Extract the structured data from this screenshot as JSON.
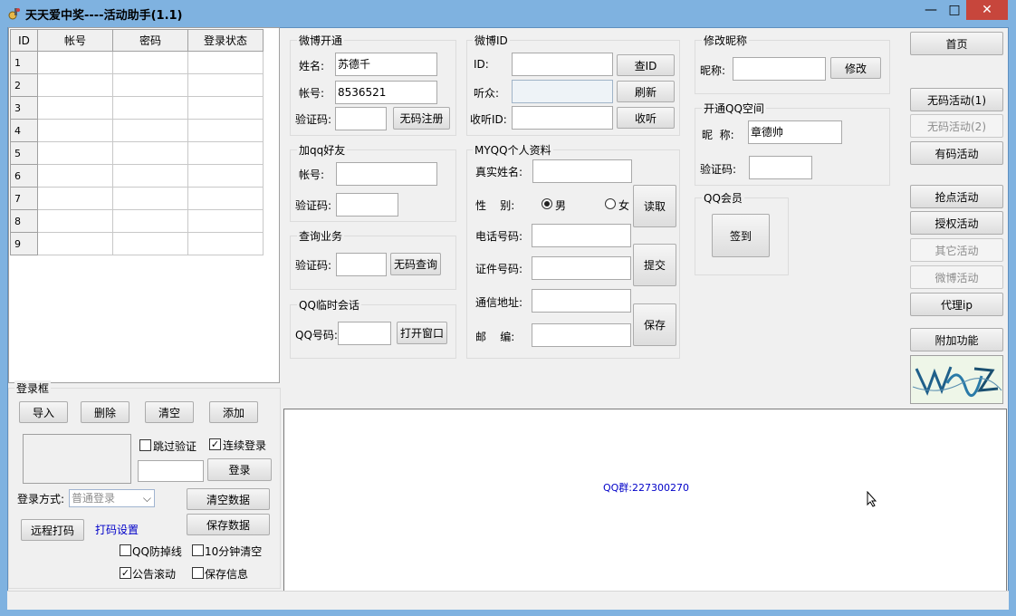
{
  "window": {
    "title": "天天爱中奖----活动助手(1.1)",
    "min_label": "—",
    "max_label": "□",
    "close_label": "✕"
  },
  "accounts": {
    "headers": [
      "ID",
      "帐号",
      "密码",
      "登录状态"
    ],
    "rows": [
      "1",
      "2",
      "3",
      "4",
      "5",
      "6",
      "7",
      "8",
      "9"
    ]
  },
  "login_box": {
    "group_label": "登录框",
    "import": "导入",
    "delete": "删除",
    "clear": "清空",
    "add": "添加",
    "skip_verify": "跳过验证",
    "continuous_login": "连续登录",
    "login": "登录",
    "login_mode_label": "登录方式:",
    "login_mode_value": "普通登录",
    "clear_data": "清空数据",
    "save_data": "保存数据",
    "remote_captcha": "远程打码",
    "captcha_settings": "打码设置",
    "qq_anti_drop": "QQ防掉线",
    "clear_10min": "10分钟清空",
    "notice_scroll": "公告滚动",
    "save_info": "保存信息",
    "skip_verify_checked": false,
    "continuous_login_checked": true,
    "qq_anti_drop_checked": false,
    "clear_10min_checked": false,
    "notice_scroll_checked": true,
    "save_info_checked": false
  },
  "weibo_open": {
    "title": "微博开通",
    "name_label": "姓名:",
    "name_value": "苏德千",
    "account_label": "帐号:",
    "account_value": "8536521",
    "captcha_label": "验证码:",
    "register_button": "无码注册"
  },
  "add_qq": {
    "title": "加qq好友",
    "account_label": "帐号:",
    "captcha_label": "验证码:"
  },
  "query": {
    "title": "查询业务",
    "captcha_label": "验证码:",
    "query_button": "无码查询"
  },
  "qq_chat": {
    "title": "QQ临时会话",
    "qq_label": "QQ号码:",
    "open_button": "打开窗口"
  },
  "weibo_id": {
    "title": "微博ID",
    "id_label": "ID:",
    "check_button": "查ID",
    "listeners_label": "听众:",
    "refresh_button": "刷新",
    "listen_id_label": "收听ID:",
    "listen_button": "收听"
  },
  "myqq": {
    "title": "MYQQ个人资料",
    "real_name": "真实姓名:",
    "gender": "性    别:",
    "male": "男",
    "female": "女",
    "male_selected": true,
    "read_button": "读取",
    "phone": "电话号码:",
    "id_number": "证件号码:",
    "submit_button": "提交",
    "address": "通信地址:",
    "postcode": "邮    编:",
    "save_button": "保存"
  },
  "nickname": {
    "title": "修改昵称",
    "label": "昵称:",
    "button": "修改"
  },
  "qzone": {
    "title": "开通QQ空间",
    "nickname_label": "昵  称:",
    "nickname_value": "章德帅",
    "captcha_label": "验证码:"
  },
  "qq_vip": {
    "title": "QQ会员",
    "sign_button": "签到"
  },
  "right_menu": {
    "home": "首页",
    "no_code_1": "无码活动(1)",
    "no_code_2": "无码活动(2)",
    "code_activity": "有码活动",
    "grab_points": "抢点活动",
    "auth_activity": "授权活动",
    "other_activity": "其它活动",
    "weibo_activity": "微博活动",
    "proxy_ip": "代理ip",
    "extra": "附加功能"
  },
  "notice": {
    "text": "QQ群:227300270"
  },
  "colors": {
    "title_bar": "#7fb2e0",
    "close": "#c7463c",
    "link": "#0000c8"
  }
}
